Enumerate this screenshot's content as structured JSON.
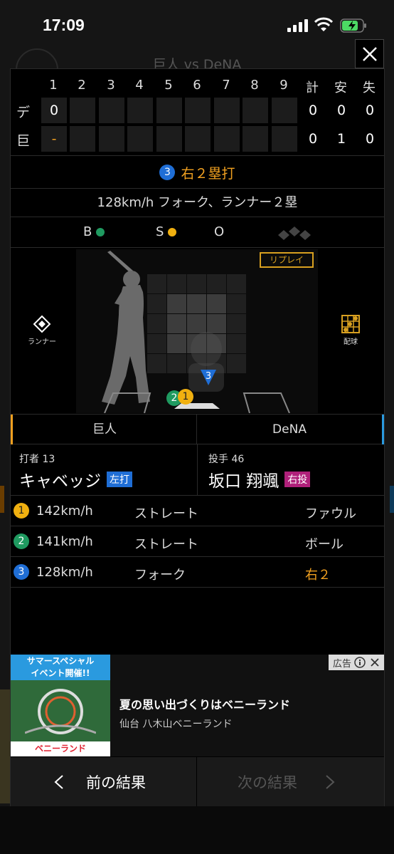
{
  "status_bar": {
    "time": "17:09"
  },
  "background": {
    "title": "巨人 vs DeNA"
  },
  "scoreboard": {
    "innings": [
      "1",
      "2",
      "3",
      "4",
      "5",
      "6",
      "7",
      "8",
      "9"
    ],
    "totals_headers": [
      "計",
      "安",
      "失"
    ],
    "teams": [
      {
        "abbr": "デ",
        "innings": [
          "0",
          "",
          "",
          "",
          "",
          "",
          "",
          "",
          ""
        ],
        "totals": [
          "0",
          "0",
          "0"
        ]
      },
      {
        "abbr": "巨",
        "innings": [
          "-",
          "",
          "",
          "",
          "",
          "",
          "",
          "",
          ""
        ],
        "totals": [
          "0",
          "1",
          "0"
        ]
      }
    ]
  },
  "play": {
    "number": "3",
    "result": "右２塁打",
    "pitch_summary": "128km/h フォーク、ランナー２塁"
  },
  "count": {
    "b_label": "B",
    "s_label": "S",
    "o_label": "O",
    "balls": 1,
    "strikes": 1,
    "outs": 0
  },
  "field": {
    "replay_label": "リプレイ",
    "runner_label": "ランナー",
    "pitch_chart_label": "配球",
    "pitch_markers": [
      "1",
      "2",
      "3"
    ]
  },
  "teams": {
    "home": "巨人",
    "away": "DeNA"
  },
  "batter": {
    "role": "打者 13",
    "name": "キャベッジ",
    "hand": "左打"
  },
  "pitcher": {
    "role": "投手 46",
    "name": "坂口 翔颯",
    "hand": "右投"
  },
  "pitches": [
    {
      "num": "1",
      "speed": "142km/h",
      "type": "ストレート",
      "result": "ファウル",
      "color": "#f0b010"
    },
    {
      "num": "2",
      "speed": "141km/h",
      "type": "ストレート",
      "result": "ボール",
      "color": "#1f9a60"
    },
    {
      "num": "3",
      "speed": "128km/h",
      "type": "フォーク",
      "result": "右２",
      "color": "#1f6ed6"
    }
  ],
  "ad": {
    "tag": "広告",
    "image_top": "サマースペシャル\nイベント開催!!",
    "image_bottom": "ベニーランド",
    "title": "夏の思い出づくりはベニーランド",
    "subtitle": "仙台 八木山ベニーランド"
  },
  "nav": {
    "prev": "前の結果",
    "next": "次の結果"
  },
  "colors": {
    "accent_orange": "#f0a020",
    "left_hand": "#1f6ed6",
    "right_hand": "#b0207a"
  }
}
